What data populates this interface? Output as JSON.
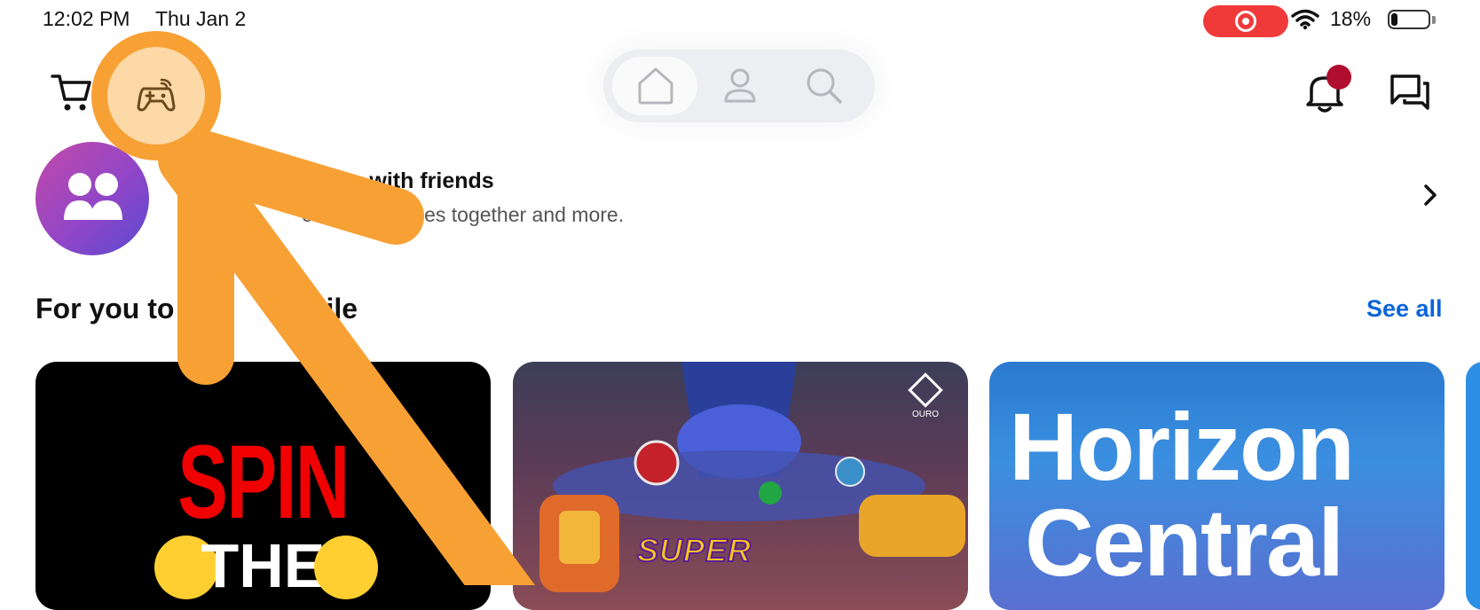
{
  "status_bar": {
    "time": "12:02 PM",
    "date": "Thu Jan 2",
    "battery_percent": "18%",
    "battery_level": 0.18,
    "recording_indicator": "screen-recording-icon",
    "colors": {
      "recording": "#f03a3a"
    }
  },
  "toolbar": {
    "left_icons": [
      "cart-icon",
      "game-controller-icon"
    ],
    "nav_tabs": [
      {
        "icon": "home-icon",
        "selected": true
      },
      {
        "icon": "person-icon",
        "selected": false
      },
      {
        "icon": "search-icon",
        "selected": false
      }
    ],
    "right_icons": [
      "bell-icon",
      "chat-icon"
    ],
    "notification_badge_color": "#b00e2f"
  },
  "friends_banner": {
    "title": "re fun with friends",
    "subtitle": "out, play games together and more."
  },
  "section": {
    "title": "For you to",
    "title_fragment": "obile",
    "see_all": "See all",
    "accent_color": "#0a66d8"
  },
  "cards": [
    {
      "line1": "SPIN",
      "line2": "THE"
    },
    {
      "title": "SUPER",
      "badge": "OURO"
    },
    {
      "line1": "Horizon",
      "line2": "Central"
    }
  ],
  "annotation": {
    "highlight_color": "#f7a034",
    "highlight_fill": "#fcd9a6"
  }
}
